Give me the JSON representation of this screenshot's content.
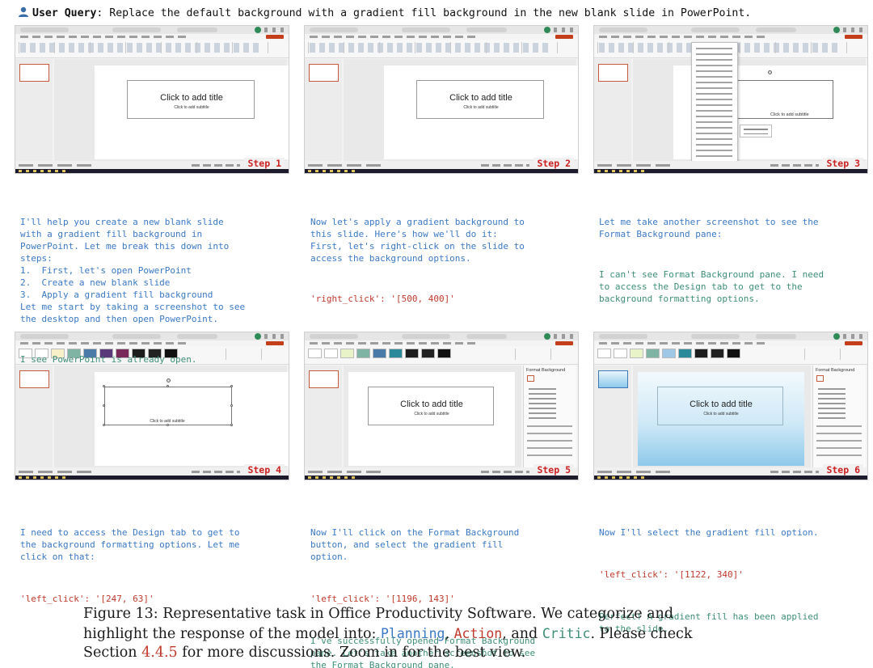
{
  "query": {
    "label": "User Query",
    "text": ": Replace the default background with a gradient fill background in the new blank slide in PowerPoint."
  },
  "slide": {
    "title_placeholder": "Click to add title",
    "subtitle_placeholder": "Click to add subtitle"
  },
  "panels": [
    {
      "step": "Step 1"
    },
    {
      "step": "Step 2"
    },
    {
      "step": "Step 3"
    },
    {
      "step": "Step 4"
    },
    {
      "step": "Step 5"
    },
    {
      "step": "Step 6"
    }
  ],
  "pane": {
    "title": "Format Background"
  },
  "texts": {
    "s1_plan": "I'll help you create a new blank slide\nwith a gradient fill background in\nPowerPoint. Let me break this down into\nsteps:\n1.  First, let's open PowerPoint\n2.  Create a new blank slide\n3.  Apply a gradient fill background\nLet me start by taking a screenshot to see\nthe desktop and then open PowerPoint.",
    "s1_critic": "I see PowerPoint is already open.",
    "s2_plan": "Now let's apply a gradient background to\nthis slide. Here's how we'll do it:\nFirst, let's right-click on the slide to\naccess the background options.",
    "s2_action": "'right_click': '[500, 400]'",
    "s3_plan": "Let me take another screenshot to see the\nFormat Background pane:",
    "s3_critic": "I can't see Format Background pane. I need\nto access the Design tab to get to the\nbackground formatting options.",
    "s4_plan": "I need to access the Design tab to get to\nthe background formatting options. Let me\nclick on that:",
    "s4_action": "'left_click': '[247, 63]'",
    "s5_plan": "Now I'll click on the Format Background\nbutton, and select the gradient fill\noption.",
    "s5_action": "'left_click': '[1196, 143]'",
    "s5_critic": "I've successfully opened Format Background\npane. Let's take another screenshot to see\nthe Format Background pane.",
    "s6_plan": "Now I'll select the gradient fill option.",
    "s6_action": "'left_click': '[1122, 340]'",
    "s6_critic": "Perfect! A gradient fill has been applied\nto the slide."
  },
  "caption": {
    "l1": "Figure 13: Representative task in Office Productivity Software.  We categorize and",
    "l2_a": "highlight the response of the model into: ",
    "planning": "Planning",
    "sep1": ", ",
    "action": "Action",
    "sep2": ", and ",
    "critic": "Critic",
    "l2_b": ".  Please check",
    "l3_a": "Section ",
    "ref": "4.4.5",
    "l3_b": " for more discussions. Zoom in for the best view."
  },
  "colors": {
    "planning": "#3b79c4",
    "action": "#c0392b",
    "critic": "#3f8f78",
    "step_label": "#cc2222"
  }
}
